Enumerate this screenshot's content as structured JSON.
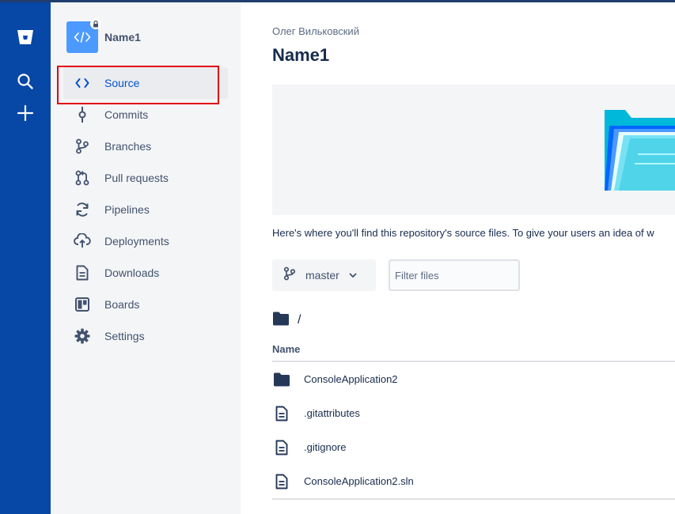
{
  "repository": {
    "owner": "Олег Вильковский",
    "name": "Name1"
  },
  "sidebar": {
    "items": [
      {
        "label": "Source",
        "icon": "code-icon",
        "active": true
      },
      {
        "label": "Commits",
        "icon": "commit-icon"
      },
      {
        "label": "Branches",
        "icon": "branch-icon"
      },
      {
        "label": "Pull requests",
        "icon": "pull-request-icon"
      },
      {
        "label": "Pipelines",
        "icon": "pipelines-icon"
      },
      {
        "label": "Deployments",
        "icon": "deployments-icon"
      },
      {
        "label": "Downloads",
        "icon": "downloads-icon"
      },
      {
        "label": "Boards",
        "icon": "boards-icon"
      },
      {
        "label": "Settings",
        "icon": "gear-icon"
      }
    ]
  },
  "main": {
    "description": "Here's where you'll find this repository's source files. To give your users an idea of w",
    "branch": "master",
    "filter_placeholder": "Filter files",
    "path": "/",
    "column_name": "Name",
    "files": [
      {
        "name": "ConsoleApplication2",
        "type": "folder"
      },
      {
        "name": ".gitattributes",
        "type": "file"
      },
      {
        "name": ".gitignore",
        "type": "file"
      },
      {
        "name": "ConsoleApplication2.sln",
        "type": "file"
      }
    ]
  },
  "colors": {
    "rail": "#0747a6",
    "sidebar": "#f4f5f7",
    "active_text": "#0052cc",
    "highlight_box": "#e3000f"
  }
}
